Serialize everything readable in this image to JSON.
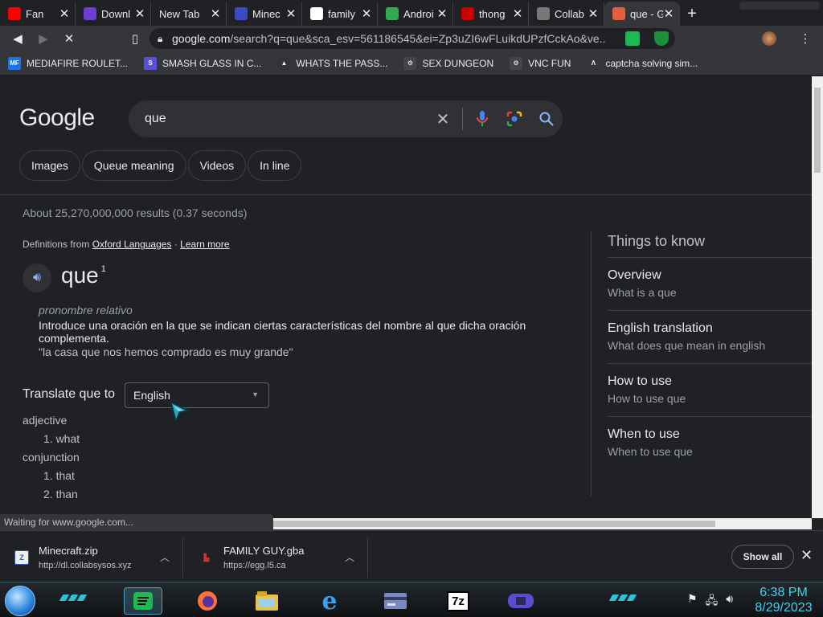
{
  "tabs": [
    {
      "title": "Fan",
      "fav": "youtube-icon",
      "color": "#ff0000"
    },
    {
      "title": "Downl",
      "fav": "download-icon",
      "color": "#6b3fd1"
    },
    {
      "title": "New Tab",
      "fav": "",
      "color": ""
    },
    {
      "title": "Minec",
      "fav": "ml-icon",
      "color": "#3b4cc0"
    },
    {
      "title": "family",
      "fav": "google-icon",
      "color": "#ffffff"
    },
    {
      "title": "Androi",
      "fav": "play-icon",
      "color": "#34a853"
    },
    {
      "title": "thong",
      "fav": "flag-icon",
      "color": "#c00"
    },
    {
      "title": "Collab",
      "fav": "globe-icon",
      "color": "#777"
    },
    {
      "title": "que - G",
      "fav": "loading-icon",
      "color": "#e06040"
    }
  ],
  "omnibox": {
    "host": "google.com",
    "rest": "/search?q=que&sca_esv=561186545&ei=Zp3uZI6wFLuikdUPzfCckAo&ve..."
  },
  "bookmarks": [
    {
      "label": "MEDIAFIRE ROULET...",
      "icon": "mediafire-icon",
      "color": "#1a73e8",
      "glyph": "MF"
    },
    {
      "label": "SMASH GLASS IN C...",
      "icon": "glass-icon",
      "color": "#5a4fd8",
      "glyph": "S"
    },
    {
      "label": "WHATS THE PASS...",
      "icon": "lock-icon",
      "color": "#333",
      "glyph": "▲"
    },
    {
      "label": "SEX DUNGEON",
      "icon": "gear-icon",
      "color": "#444",
      "glyph": "⚙"
    },
    {
      "label": "VNC FUN",
      "icon": "gear-icon",
      "color": "#444",
      "glyph": "⚙"
    },
    {
      "label": "captcha solving sim...",
      "icon": "a-icon",
      "color": "#35363a",
      "glyph": "Λ"
    }
  ],
  "search": {
    "logo": "Google",
    "query": "que",
    "chips": [
      "Images",
      "Queue meaning",
      "Videos",
      "In line"
    ],
    "stats": "About 25,270,000,000 results (0.37 seconds)"
  },
  "definition": {
    "from_prefix": "Definitions from",
    "source": "Oxford Languages",
    "separator": "·",
    "learn_more": "Learn more",
    "word": "que",
    "superscript": "1",
    "part_of_speech": "pronombre relativo",
    "text": "Introduce una oración en la que se indican ciertas características del nombre al que dicha oración complementa.",
    "example": "\"la casa que nos hemos comprado es muy grande\""
  },
  "translate": {
    "label": "Translate que to",
    "selected": "English",
    "groups": [
      {
        "class": "adjective",
        "items": [
          "1. what"
        ]
      },
      {
        "class": "conjunction",
        "items": [
          "1. that",
          "2. than"
        ]
      }
    ]
  },
  "things_to_know": {
    "title": "Things to know",
    "items": [
      {
        "heading": "Overview",
        "sub": "What is a que"
      },
      {
        "heading": "English translation",
        "sub": "What does que mean in english"
      },
      {
        "heading": "How to use",
        "sub": "How to use que"
      },
      {
        "heading": "When to use",
        "sub": "When to use que"
      }
    ]
  },
  "status": "Waiting for www.google.com...",
  "downloads": [
    {
      "name": "Minecraft.zip",
      "url": "http://dl.collabsysos.xyz"
    },
    {
      "name": "FAMILY GUY.gba",
      "url": "https://egg.l5.ca"
    }
  ],
  "download_bar": {
    "show_all": "Show all"
  },
  "clock": {
    "time": "6:38 PM",
    "date": "8/29/2023"
  }
}
